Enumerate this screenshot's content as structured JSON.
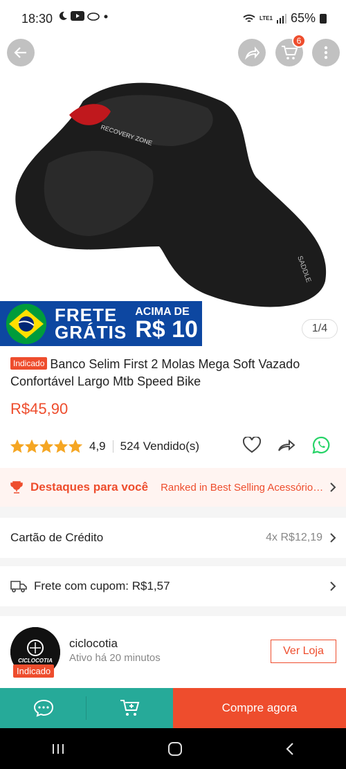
{
  "status_bar": {
    "time": "18:30",
    "network": "LTE1",
    "battery": "65%"
  },
  "header": {
    "cart_count": "6"
  },
  "banner": {
    "line1": "FRETE",
    "line2": "GRÁTIS",
    "above": "ACIMA DE",
    "amount": "R$ 10"
  },
  "gallery": {
    "counter": "1/4"
  },
  "product": {
    "tag": "Indicado",
    "title": "Banco Selim First 2 Molas Mega Soft Vazado Confortável Largo Mtb Speed Bike",
    "price": "R$45,90",
    "rating": "4,9",
    "stars": 4.9,
    "sold": "524 Vendido(s)"
  },
  "highlights": {
    "title": "Destaques para você",
    "detail": "Ranked in Best Selling Acessórios ..."
  },
  "payment": {
    "label": "Cartão de Crédito",
    "value": "4x R$12,19"
  },
  "shipping": {
    "label": "Frete com cupom: R$1,57"
  },
  "shop": {
    "name": "ciclocotia",
    "active": "Ativo há 20 minutos",
    "tag": "Indicado",
    "visit_label": "Ver Loja",
    "logo_text": "CICLOCOTIA"
  },
  "bottom_bar": {
    "buy_label": "Compre agora"
  },
  "colors": {
    "accent": "#ee4d2d",
    "teal": "#26aa99",
    "banner_blue": "#0d47a1"
  }
}
